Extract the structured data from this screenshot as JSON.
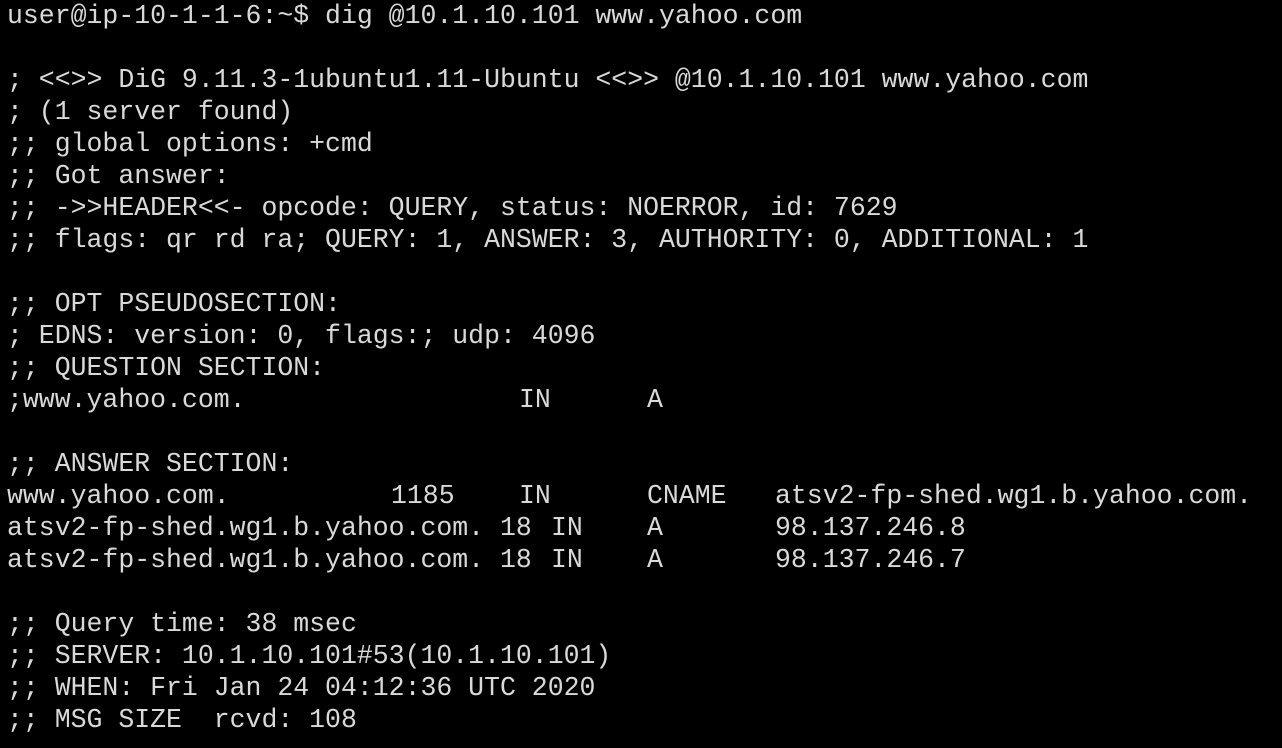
{
  "terminal": {
    "prompt": "user@ip-10-1-1-6:~$ dig @10.1.10.101 www.yahoo.com",
    "header_lines": [
      "; <<>> DiG 9.11.3-1ubuntu1.11-Ubuntu <<>> @10.1.10.101 www.yahoo.com",
      "; (1 server found)",
      ";; global options: +cmd",
      ";; Got answer:",
      ";; ->>HEADER<<- opcode: QUERY, status: NOERROR, id: 7629",
      ";; flags: qr rd ra; QUERY: 1, ANSWER: 3, AUTHORITY: 0, ADDITIONAL: 1"
    ],
    "opt_lines": [
      ";; OPT PSEUDOSECTION:",
      "; EDNS: version: 0, flags:; udp: 4096",
      ";; QUESTION SECTION:"
    ],
    "question": {
      "name": ";www.yahoo.com.",
      "class": "IN",
      "type": "A"
    },
    "answer_header": ";; ANSWER SECTION:",
    "answers": [
      {
        "name": "www.yahoo.com.",
        "ttl": "1185",
        "class": "IN",
        "type": "CNAME",
        "rdata": "atsv2-fp-shed.wg1.b.yahoo.com."
      },
      {
        "name": "atsv2-fp-shed.wg1.b.yahoo.com. 18",
        "ttl": "",
        "class": "IN",
        "type": "A",
        "rdata": "98.137.246.8"
      },
      {
        "name": "atsv2-fp-shed.wg1.b.yahoo.com. 18",
        "ttl": "",
        "class": "IN",
        "type": "A",
        "rdata": "98.137.246.7"
      }
    ],
    "footer_lines": [
      ";; Query time: 38 msec",
      ";; SERVER: 10.1.10.101#53(10.1.10.101)",
      ";; WHEN: Fri Jan 24 04:12:36 UTC 2020",
      ";; MSG SIZE  rcvd: 108"
    ]
  }
}
